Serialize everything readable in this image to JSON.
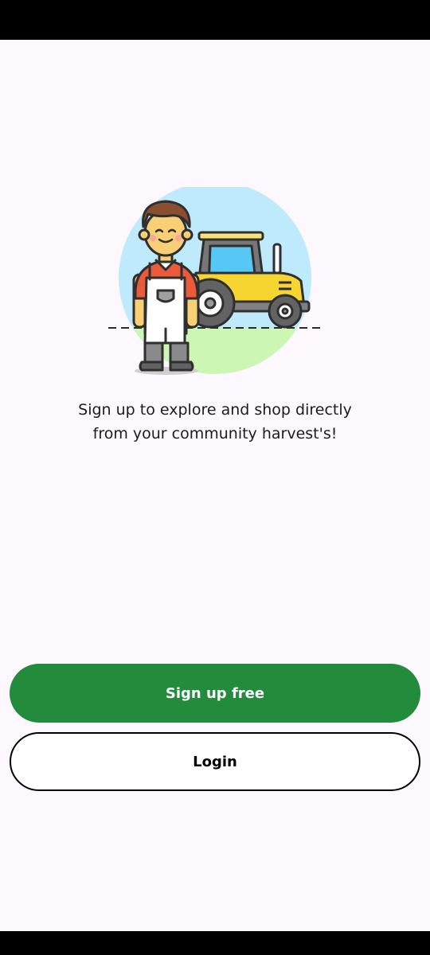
{
  "welcome": {
    "tagline_line1": "Sign up to explore and shop directly",
    "tagline_line2": "from your community harvest's!"
  },
  "actions": {
    "signup_label": "Sign up free",
    "login_label": "Login"
  },
  "illustration": {
    "icon": "farmer-with-tractor-illustration"
  },
  "colors": {
    "background": "#fdf7fe",
    "primary": "#228b3c",
    "secondary_bg": "#ffffff",
    "text": "#1d1b1e"
  }
}
